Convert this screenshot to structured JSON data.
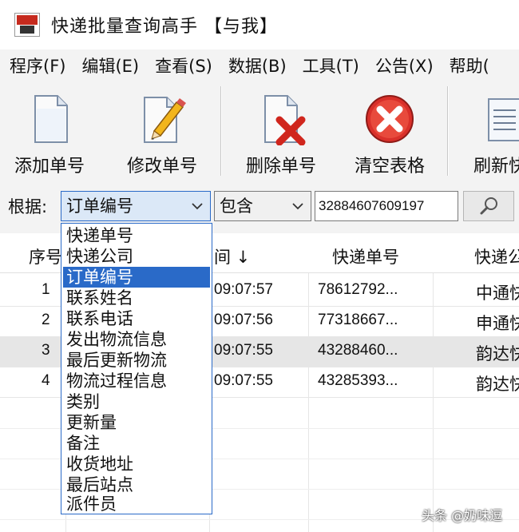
{
  "window": {
    "title": "快递批量查询高手 【与我】"
  },
  "menu": [
    "程序(F)",
    "编辑(E)",
    "查看(S)",
    "数据(B)",
    "工具(T)",
    "公告(X)",
    "帮助("
  ],
  "toolbar": {
    "add": "添加单号",
    "edit": "修改单号",
    "delete": "删除单号",
    "clear": "清空表格",
    "refresh": "刷新快"
  },
  "filter": {
    "label": "根据:",
    "field": "订单编号",
    "operator": "包含",
    "value": "32884607609197"
  },
  "dropdown": {
    "options": [
      "快递单号",
      "快递公司",
      "订单编号",
      "联系姓名",
      "联系电话",
      "发出物流信息",
      "最后更新物流",
      "物流过程信息",
      "类别",
      "更新量",
      "备注",
      "收货地址",
      "最后站点",
      "派件员"
    ],
    "selected_index": 2
  },
  "table": {
    "headers": {
      "seq": "序号",
      "time": "间 ↓",
      "tracking": "快递单号",
      "company": "快递公"
    },
    "rows": [
      {
        "seq": "1",
        "time": "09:07:57",
        "tracking": "78612792...",
        "company": "中通快"
      },
      {
        "seq": "2",
        "time": "09:07:56",
        "tracking": "77318667...",
        "company": "申通快"
      },
      {
        "seq": "3",
        "time": "09:07:55",
        "tracking": "43288460...",
        "company": "韵达快"
      },
      {
        "seq": "4",
        "time": "09:07:55",
        "tracking": "43285393...",
        "company": "韵达快"
      }
    ]
  },
  "watermark": "头条 @奶味逗"
}
